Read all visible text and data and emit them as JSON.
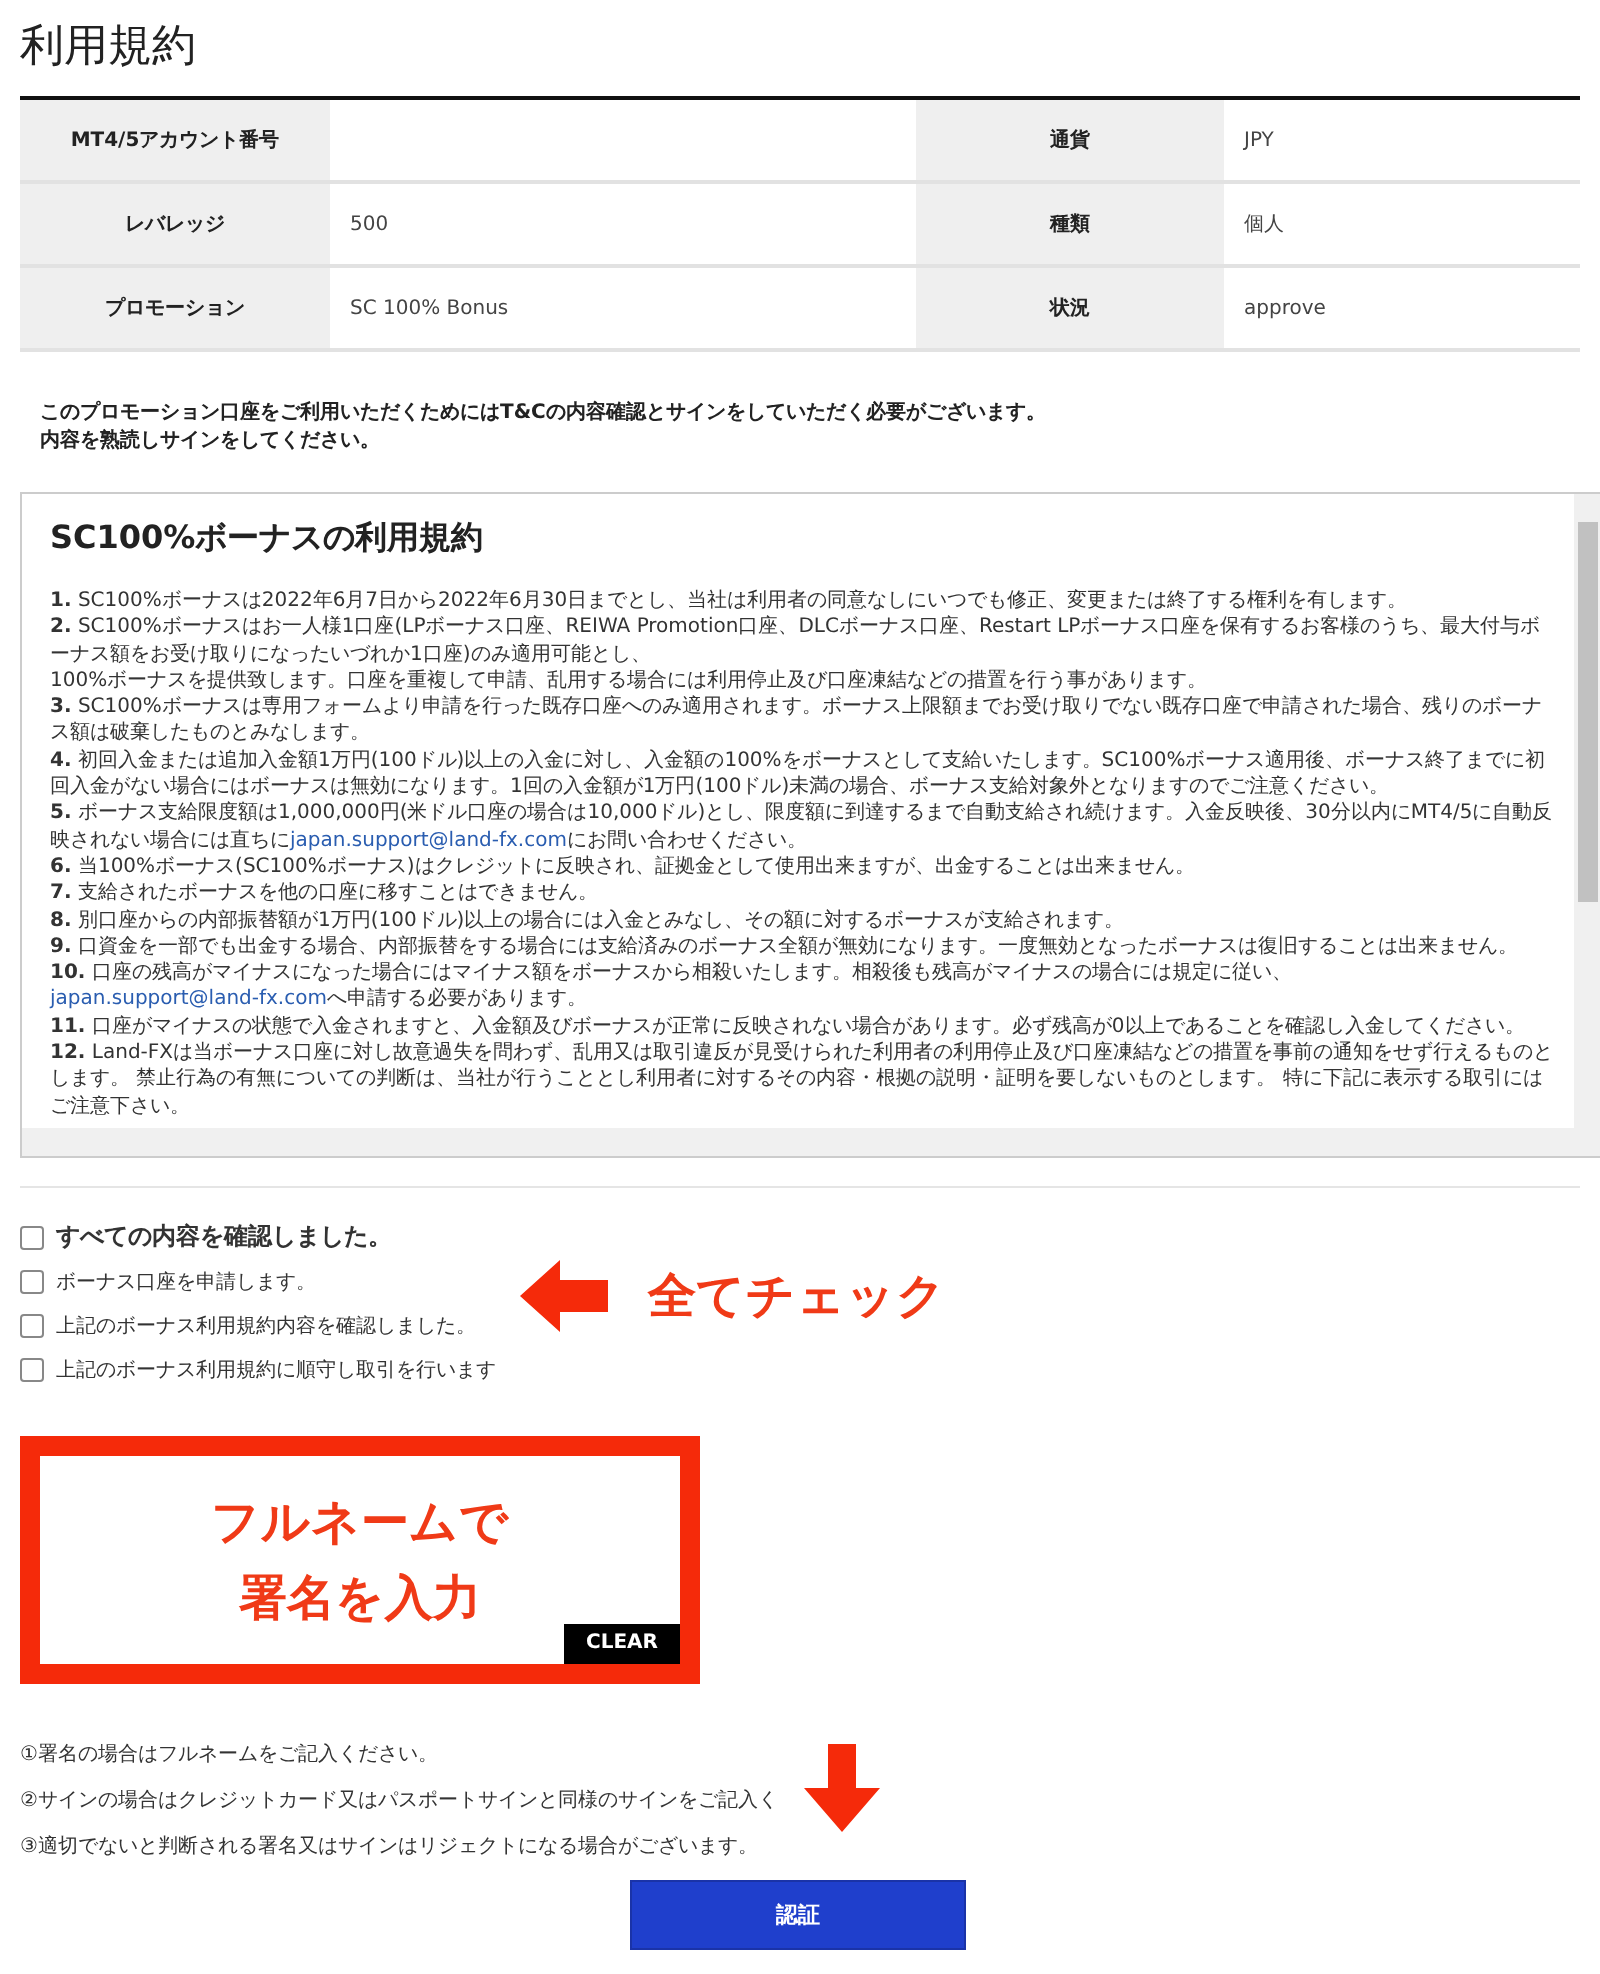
{
  "page_title": "利用規約",
  "account_table": [
    {
      "label": "MT4/5アカウント番号",
      "label_2": "通貨",
      "value_2": "JPY"
    },
    {
      "label": "レバレッジ",
      "value": "500",
      "label_2": "種類",
      "value_2": "個人"
    },
    {
      "label": "プロモーション",
      "value": "SC 100% Bonus",
      "label_2": "状況",
      "value_2": "approve"
    }
  ],
  "notice": [
    "このプロモーション口座をご利用いただくためにはT&Cの内容確認とサインをしていただく必要がございます。",
    "内容を熟読しサインをしてください。"
  ],
  "terms": {
    "title": "SC100%ボーナスの利用規約",
    "items": [
      {
        "number": "1.",
        "lines": [
          "SC100%ボーナスは2022年6月7日から2022年6月30日までとし、当社は利用者の同意なしにいつでも修正、変更または終了する権利を有します。"
        ]
      },
      {
        "number": "2.",
        "lines": [
          "SC100%ボーナスはお一人様1口座(LPボーナス口座、REIWA Promotion口座、DLCボーナス口座、Restart LPボーナス口座を保有するお客様のうち、最大付与ボーナス額をお受け取りになったいづれか1口座)のみ適用可能とし、",
          "100%ボーナスを提供致します。口座を重複して申請、乱用する場合には利用停止及び口座凍結などの措置を行う事があります。"
        ]
      },
      {
        "number": "3.",
        "lines": [
          "SC100%ボーナスは専用フォームより申請を行った既存口座へのみ適用されます。ボーナス上限額までお受け取りでない既存口座で申請された場合、残りのボーナス額は破棄したものとみなします。"
        ]
      },
      {
        "number": "4.",
        "lines": [
          "初回入金または追加入金額1万円(100ドル)以上の入金に対し、入金額の100%をボーナスとして支給いたします。SC100%ボーナス適用後、ボーナス終了までに初回入金がない場合にはボーナスは無効になります。1回の入金額が1万円(100ドル)未満の場合、ボーナス支給対象外となりますのでご注意ください。"
        ]
      },
      {
        "number": "5.",
        "lines": [
          "ボーナス支給限度額は1,000,000円(米ドル口座の場合は10,000ドル)とし、限度額に到達するまで自動支給され続けます。入金反映後、30分以内にMT4/5に自動反映されない場合には直ちに"
        ],
        "link": "japan.support@land-fx.com",
        "after": "にお問い合わせください。"
      },
      {
        "number": "6.",
        "lines": [
          "当100%ボーナス(SC100%ボーナス)はクレジットに反映され、証拠金として使用出来ますが、出金することは出来ません。"
        ]
      },
      {
        "number": "7.",
        "lines": [
          "支給されたボーナスを他の口座に移すことはできません。"
        ]
      },
      {
        "number": "8.",
        "lines": [
          "別口座からの内部振替額が1万円(100ドル)以上の場合には入金とみなし、その額に対するボーナスが支給されます。"
        ]
      },
      {
        "number": "9.",
        "lines": [
          "口資金を一部でも出金する場合、内部振替をする場合には支給済みのボーナス全額が無効になります。一度無効となったボーナスは復旧することは出来ません。"
        ]
      },
      {
        "number": "10.",
        "lines": [
          "口座の残高がマイナスになった場合にはマイナス額をボーナスから相殺いたします。相殺後も残高がマイナスの場合には規定に従い、"
        ],
        "link": "japan.support@land-fx.com",
        "after": "へ申請する必要があります。"
      },
      {
        "number": "11.",
        "lines": [
          "口座がマイナスの状態で入金されますと、入金額及びボーナスが正常に反映されない場合があります。必ず残高が0以上であることを確認し入金してください。"
        ]
      },
      {
        "number": "12.",
        "lines": [
          "Land-FXは当ボーナス口座に対し故意過失を問わず、乱用又は取引違反が見受けられた利用者の利用停止及び口座凍結などの措置を事前の通知をせず行えるものとします。 禁止行為の有無についての判断は、当社が行うこととし利用者に対するその内容・根拠の説明・証明を要しないものとします。 特に下記に表示する取引にはご注意下さい。"
        ]
      }
    ]
  },
  "checkboxes": [
    {
      "label": "すべての内容を確認しました。",
      "checked": false,
      "kind": "master"
    },
    {
      "label": "ボーナス口座を申請します。",
      "checked": false,
      "kind": "item"
    },
    {
      "label": "上記のボーナス利用規約内容を確認しました。",
      "checked": false,
      "kind": "item"
    },
    {
      "label": "上記のボーナス利用規約に順守し取引を行います",
      "checked": false,
      "kind": "item"
    }
  ],
  "annotation_check": "全てチェック",
  "signature_pad": {
    "annotation": [
      "フルネームで",
      "署名を入力"
    ],
    "clear_button": "CLEAR"
  },
  "notes": [
    "①署名の場合はフルネームをご記入ください。",
    "②サインの場合はクレジットカード又はパスポートサインと同様のサインをご記入く",
    "③適切でないと判断される署名又はサインはリジェクトになる場合がございます。"
  ],
  "submit_button": "認証"
}
